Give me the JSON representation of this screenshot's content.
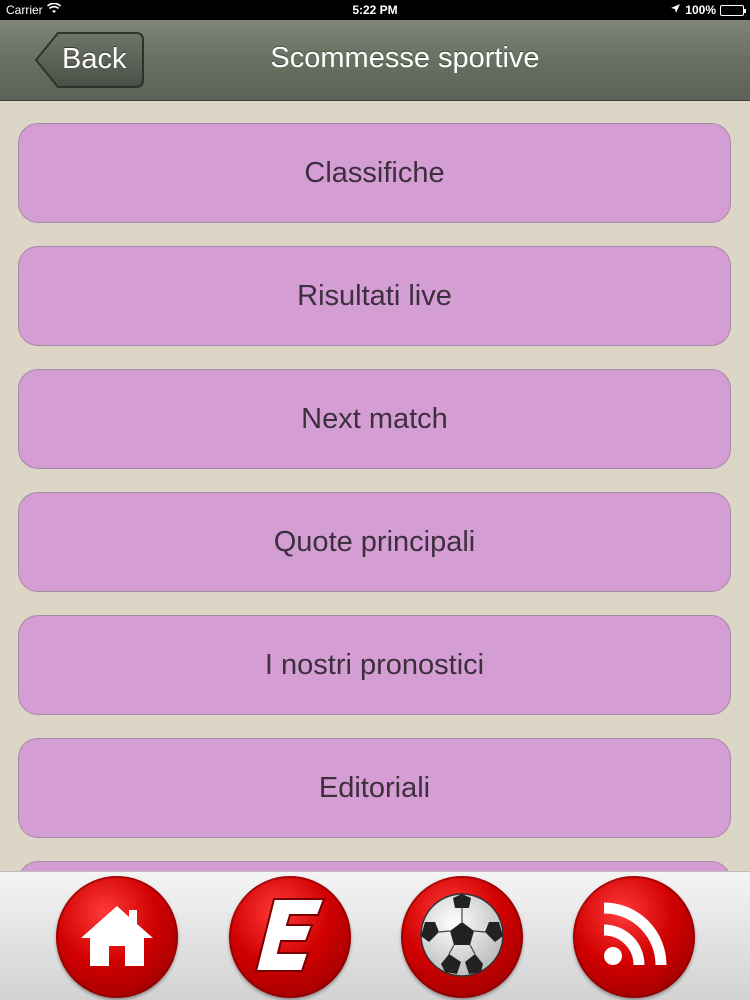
{
  "status_bar": {
    "carrier": "Carrier",
    "time": "5:22 PM",
    "battery": "100%",
    "icons": [
      "wifi-icon",
      "location-arrow-icon",
      "battery-icon"
    ]
  },
  "navbar": {
    "back_label": "Back",
    "title": "Scommesse sportive"
  },
  "menu": {
    "items": [
      {
        "label": "Classifiche"
      },
      {
        "label": "Risultati live"
      },
      {
        "label": "Next match"
      },
      {
        "label": "Quote principali"
      },
      {
        "label": "I nostri pronostici"
      },
      {
        "label": "Editoriali"
      },
      {
        "label": ""
      }
    ]
  },
  "tabbar": {
    "tabs": [
      {
        "icon": "home-icon"
      },
      {
        "icon": "e-logo-icon"
      },
      {
        "icon": "soccer-ball-icon"
      },
      {
        "icon": "rss-icon"
      }
    ]
  },
  "colors": {
    "background": "#ddd6c6",
    "button": "#d49ed5",
    "navbar": "#687062",
    "tab_red": "#d10000"
  }
}
